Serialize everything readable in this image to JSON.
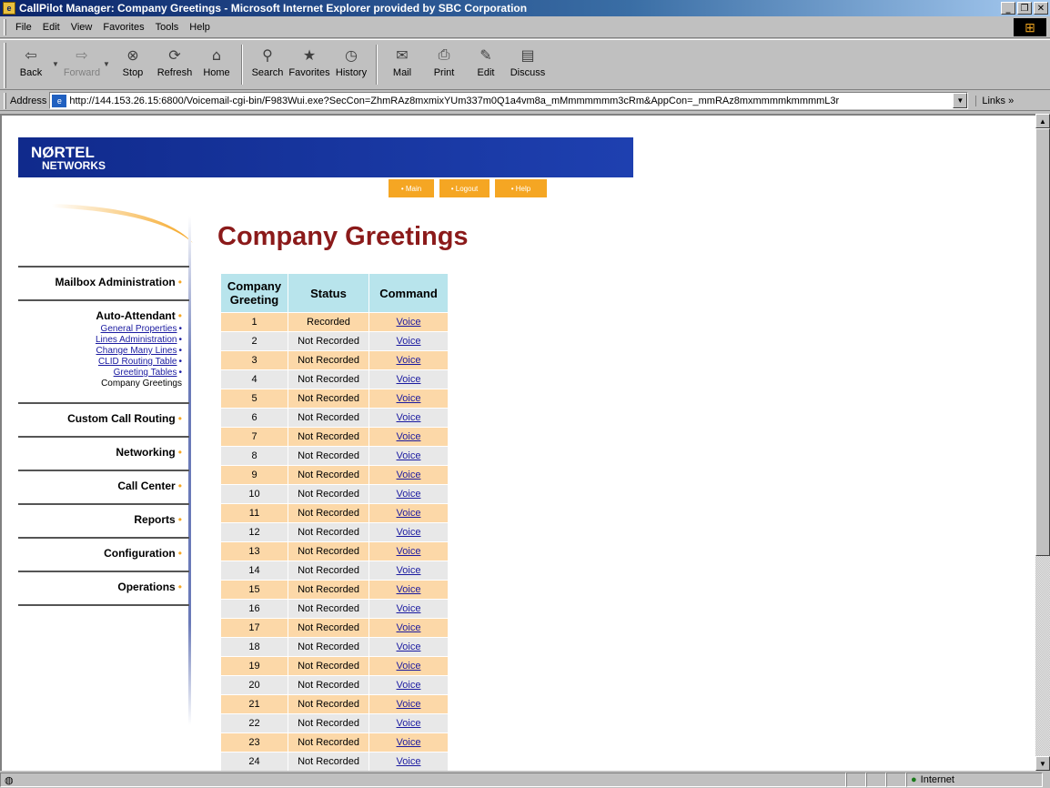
{
  "window": {
    "title": "CallPilot Manager: Company Greetings - Microsoft Internet Explorer provided by SBC Corporation"
  },
  "menu": [
    "File",
    "Edit",
    "View",
    "Favorites",
    "Tools",
    "Help"
  ],
  "toolbar": [
    {
      "label": "Back",
      "icon": "back-arrow-icon",
      "glyph": "⇦"
    },
    {
      "label": "Forward",
      "icon": "forward-arrow-icon",
      "glyph": "⇨"
    },
    {
      "label": "Stop",
      "icon": "stop-icon",
      "glyph": "⊗"
    },
    {
      "label": "Refresh",
      "icon": "refresh-icon",
      "glyph": "⟳"
    },
    {
      "label": "Home",
      "icon": "home-icon",
      "glyph": "⌂"
    },
    {
      "label": "Search",
      "icon": "search-icon",
      "glyph": "⚲"
    },
    {
      "label": "Favorites",
      "icon": "favorites-icon",
      "glyph": "★"
    },
    {
      "label": "History",
      "icon": "history-icon",
      "glyph": "◷"
    },
    {
      "label": "Mail",
      "icon": "mail-icon",
      "glyph": "✉"
    },
    {
      "label": "Print",
      "icon": "print-icon",
      "glyph": "⎙"
    },
    {
      "label": "Edit",
      "icon": "edit-icon",
      "glyph": "✎"
    },
    {
      "label": "Discuss",
      "icon": "discuss-icon",
      "glyph": "▤"
    }
  ],
  "address": {
    "label": "Address",
    "url": "http://144.153.26.15:6800/Voicemail-cgi-bin/F983Wui.exe?SecCon=ZhmRAz8mxmixYUm337m0Q1a4vm8a_mMmmmmmm3cRm&AppCon=_mmRAz8mxmmmmkmmmmL3r",
    "links": "Links »"
  },
  "brand": {
    "line1": "NØRTEL",
    "line2": "NETWORKS"
  },
  "nav": {
    "main": "• Main",
    "logout": "• Logout",
    "help": "• Help"
  },
  "page_title": "Company Greetings",
  "sidebar": {
    "sections": [
      {
        "label": "Mailbox Administration"
      },
      {
        "label": "Auto-Attendant",
        "items": [
          {
            "label": "General Properties",
            "link": true
          },
          {
            "label": "Lines Administration",
            "link": true
          },
          {
            "label": "Change Many Lines",
            "link": true
          },
          {
            "label": "CLID Routing Table",
            "link": true
          },
          {
            "label": "Greeting Tables",
            "link": true
          },
          {
            "label": "Company Greetings",
            "link": false
          }
        ]
      },
      {
        "label": "Custom Call Routing"
      },
      {
        "label": "Networking"
      },
      {
        "label": "Call Center"
      },
      {
        "label": "Reports"
      },
      {
        "label": "Configuration"
      },
      {
        "label": "Operations"
      }
    ]
  },
  "table": {
    "headers": [
      "Company Greeting",
      "Status",
      "Command"
    ],
    "rows": [
      {
        "num": "1",
        "status": "Recorded",
        "command": "Voice"
      },
      {
        "num": "2",
        "status": "Not Recorded",
        "command": "Voice"
      },
      {
        "num": "3",
        "status": "Not Recorded",
        "command": "Voice"
      },
      {
        "num": "4",
        "status": "Not Recorded",
        "command": "Voice"
      },
      {
        "num": "5",
        "status": "Not Recorded",
        "command": "Voice"
      },
      {
        "num": "6",
        "status": "Not Recorded",
        "command": "Voice"
      },
      {
        "num": "7",
        "status": "Not Recorded",
        "command": "Voice"
      },
      {
        "num": "8",
        "status": "Not Recorded",
        "command": "Voice"
      },
      {
        "num": "9",
        "status": "Not Recorded",
        "command": "Voice"
      },
      {
        "num": "10",
        "status": "Not Recorded",
        "command": "Voice"
      },
      {
        "num": "11",
        "status": "Not Recorded",
        "command": "Voice"
      },
      {
        "num": "12",
        "status": "Not Recorded",
        "command": "Voice"
      },
      {
        "num": "13",
        "status": "Not Recorded",
        "command": "Voice"
      },
      {
        "num": "14",
        "status": "Not Recorded",
        "command": "Voice"
      },
      {
        "num": "15",
        "status": "Not Recorded",
        "command": "Voice"
      },
      {
        "num": "16",
        "status": "Not Recorded",
        "command": "Voice"
      },
      {
        "num": "17",
        "status": "Not Recorded",
        "command": "Voice"
      },
      {
        "num": "18",
        "status": "Not Recorded",
        "command": "Voice"
      },
      {
        "num": "19",
        "status": "Not Recorded",
        "command": "Voice"
      },
      {
        "num": "20",
        "status": "Not Recorded",
        "command": "Voice"
      },
      {
        "num": "21",
        "status": "Not Recorded",
        "command": "Voice"
      },
      {
        "num": "22",
        "status": "Not Recorded",
        "command": "Voice"
      },
      {
        "num": "23",
        "status": "Not Recorded",
        "command": "Voice"
      },
      {
        "num": "24",
        "status": "Not Recorded",
        "command": "Voice"
      }
    ]
  },
  "status_bar": {
    "zone": "Internet"
  },
  "colors": {
    "banner": "#102a8c",
    "nav_orange": "#f5a623",
    "title_red": "#8b1a1a",
    "header_cyan": "#b8e4ec",
    "row_orange": "#fcd8a8",
    "row_grey": "#e8e8e8"
  }
}
